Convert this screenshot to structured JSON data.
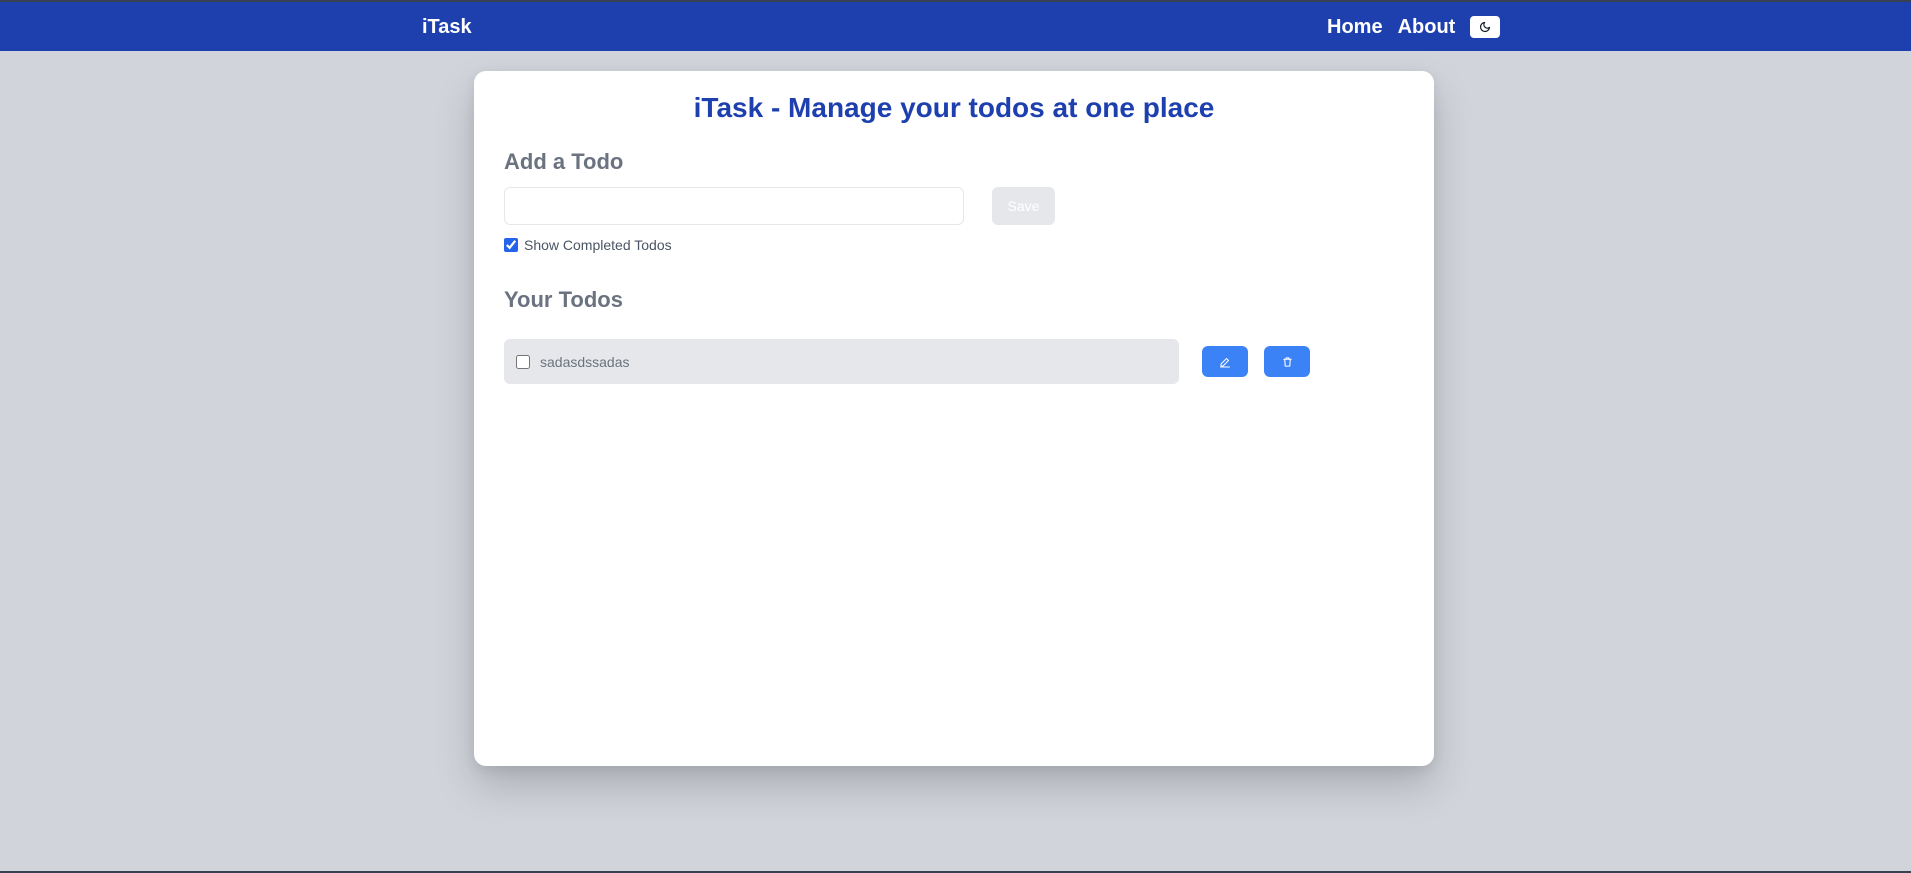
{
  "navbar": {
    "brand": "iTask",
    "links": [
      "Home",
      "About"
    ],
    "theme_toggle_icon": "moon-icon",
    "background": "#1e40af"
  },
  "main": {
    "title": "iTask - Manage your todos at one place",
    "add_section": {
      "heading": "Add a Todo",
      "input_value": "",
      "save_label": "Save",
      "show_completed_label": "Show Completed Todos",
      "show_completed_checked": true
    },
    "list_section": {
      "heading": "Your Todos",
      "todos": [
        {
          "text": "sadasdssadas",
          "completed": false,
          "edit_icon": "pencil-icon",
          "delete_icon": "trash-icon"
        }
      ]
    }
  },
  "colors": {
    "accent": "#1e40af",
    "button": "#3b82f6",
    "page_background": "#d1d5db"
  }
}
